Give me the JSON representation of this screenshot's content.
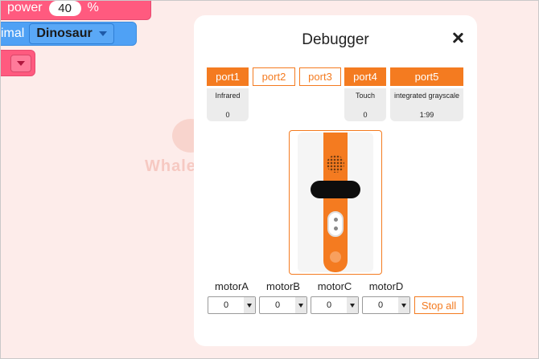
{
  "workspace": {
    "power_block": {
      "label": "power",
      "value": "40",
      "unit": "%"
    },
    "animal_block": {
      "label": "imal",
      "dropdown_value": "Dinosaur"
    },
    "watermark_text": "Whale"
  },
  "debugger": {
    "title": "Debugger",
    "ports": [
      {
        "label": "port1",
        "active": true,
        "sensor": "Infrared",
        "value": "0"
      },
      {
        "label": "port2",
        "active": false
      },
      {
        "label": "port3",
        "active": false
      },
      {
        "label": "port4",
        "active": true,
        "sensor": "Touch",
        "value": "0"
      },
      {
        "label": "port5",
        "active": true,
        "sensor": "integrated grayscale",
        "value": "1:99"
      }
    ],
    "motors": [
      {
        "label": "motorA",
        "value": "0"
      },
      {
        "label": "motorB",
        "value": "0"
      },
      {
        "label": "motorC",
        "value": "0"
      },
      {
        "label": "motorD",
        "value": "0"
      }
    ],
    "stop_all_label": "Stop all"
  },
  "colors": {
    "accent": "#f47b20",
    "block_pink": "#ff5a7f",
    "block_blue": "#4fa1f5",
    "workspace_bg": "#fdecea"
  },
  "icons": [
    "close-icon",
    "dropdown-arrow-icon",
    "robot-image"
  ]
}
